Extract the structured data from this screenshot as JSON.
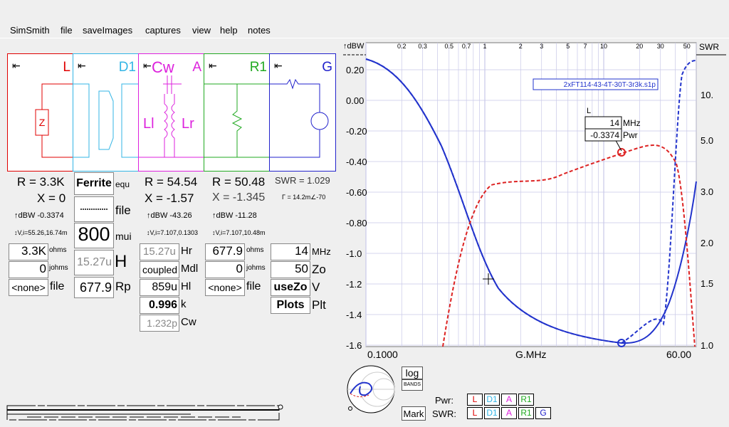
{
  "menu": [
    "SimSmith",
    "file",
    "saveImages",
    "captures",
    "view",
    "help",
    "notes"
  ],
  "panels": {
    "L": {
      "label": "L",
      "color": "#e00000"
    },
    "D1": {
      "label": "D1",
      "color": "#33b5e5"
    },
    "A": {
      "label": "A",
      "sub": "Cw",
      "color": "#dd22dd"
    },
    "R1": {
      "label": "R1",
      "color": "#22aa22"
    },
    "G": {
      "label": "G",
      "color": "#2222cc"
    },
    "arrow": "⇤"
  },
  "l_col": {
    "r": "R = 3.3K",
    "x": "X = 0",
    "dbw": "↑dBW -0.3374",
    "vi": "↕V,i=55.26,16.74m",
    "val1": "3.3K",
    "unit1": "ohms",
    "val2": "0",
    "unit2": "johms",
    "val3": "<none>",
    "unit3": "file",
    "z_label": "Z"
  },
  "d1_col": {
    "ferrite": "Ferrite",
    "equ": "equ",
    "file": "file",
    "mui_val": "800",
    "mui": "mui",
    "h_val": "15.27u",
    "h": "H",
    "rp_val": "677.9",
    "rp": "Rp"
  },
  "a_col": {
    "r": "R = 54.54",
    "x": "X = -1.57",
    "dbw": "↑dBW -43.26",
    "vi": "↕V,i=7.107,0.1303",
    "ll": "Ll",
    "lr": "Lr",
    "rows": [
      {
        "v": "15.27u",
        "u": "Hr"
      },
      {
        "v": "coupled",
        "u": "Mdl"
      },
      {
        "v": "859u",
        "u": "Hl"
      },
      {
        "v": "0.996",
        "u": "k"
      },
      {
        "v": "1.232p",
        "u": "Cw"
      }
    ]
  },
  "r1_col": {
    "r": "R = 50.48",
    "x": "X = -1.345",
    "dbw": "↑dBW -11.28",
    "vi": "↕V,i=7.107,10.48m",
    "val1": "677.9",
    "unit1": "ohms",
    "val2": "0",
    "unit2": "johms",
    "val3": "<none>",
    "unit3": "file"
  },
  "g_col": {
    "swr": "SWR = 1.029",
    "gamma": "Γ = 14.2m∠-70",
    "rows": [
      {
        "v": "14",
        "u": "MHz"
      },
      {
        "v": "50",
        "u": "Zo"
      },
      {
        "v": "useZo",
        "u": "V"
      },
      {
        "v": "Plots",
        "u": "Plt"
      }
    ]
  },
  "plot": {
    "ylabel_left": "↑dBW",
    "ylabel_right": "SWR",
    "y_ticks": [
      "0.20",
      "0.00",
      "-0.20",
      "-0.40",
      "-0.60",
      "-0.80",
      "-1.0",
      "-1.2",
      "-1.4",
      "-1.6"
    ],
    "swr_ticks": [
      "10.",
      "5.0",
      "3.0",
      "2.0",
      "1.5",
      "1.0"
    ],
    "top_ticks": [
      "0.2",
      "0.3",
      "0.5",
      "0.7",
      "1",
      "2",
      "3",
      "5",
      "7",
      "10",
      "20",
      "30",
      "50"
    ],
    "x_left": "0.1000",
    "x_mid": "G.MHz",
    "x_right": "60.00",
    "file_label": "2xFT114-43-4T-30T-3r3k.s1p",
    "marker": {
      "title": "L",
      "freq": "14",
      "freq_unit": "MHz",
      "pwr": "-0.3374",
      "pwr_unit": "Pwr"
    },
    "colors": {
      "pwr": "#dd2222",
      "swr": "#2233cc",
      "grid": "#c8c8e8"
    }
  },
  "bottom": {
    "log": "log",
    "bands": "BANDS",
    "mark": "Mark",
    "pwr": "Pwr:",
    "swr": "SWR:",
    "pwr_boxes": [
      "L",
      "D1",
      "A",
      "R1"
    ],
    "swr_boxes": [
      "L",
      "D1",
      "A",
      "R1",
      "G"
    ]
  }
}
